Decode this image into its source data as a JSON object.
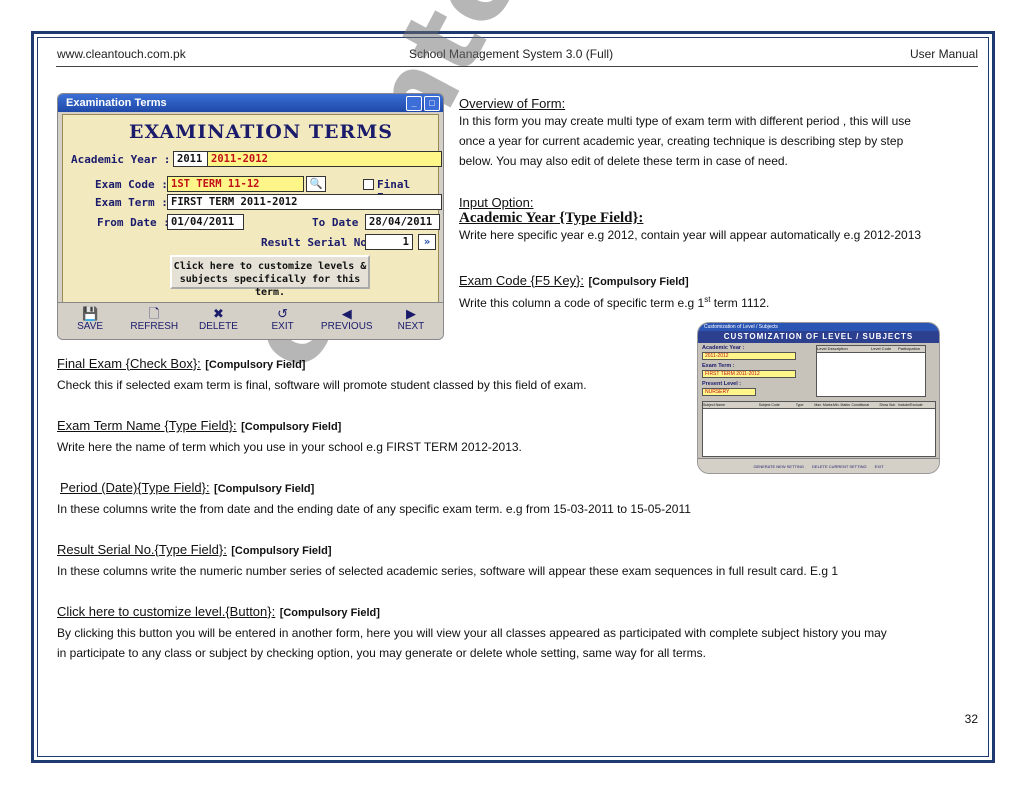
{
  "header": {
    "left": "www.cleantouch.com.pk",
    "center": "School Management System 3.0 (Full)",
    "right": "User Manual"
  },
  "watermark": "cleantouch.com.pk",
  "exam_form": {
    "window_title": "Examination Terms",
    "banner": "EXAMINATION TERMS",
    "academic_year_label": "Academic Year :",
    "academic_year_code": "2011",
    "academic_year_value": "2011-2012",
    "exam_code_label": "Exam Code :",
    "exam_code_value": "1ST TERM 11-12",
    "final_exam_label": "Final Exam",
    "exam_term_label": "Exam Term :",
    "exam_term_value": "FIRST TERM 2011-2012",
    "from_date_label": "From Date :",
    "from_date_value": "01/04/2011",
    "to_date_label": "To Date :",
    "to_date_value": "28/04/2011",
    "result_serial_label": "Result Serial No. :",
    "result_serial_value": "1",
    "customize_button_line1": "Click here to customize levels &",
    "customize_button_line2": "subjects specifically for this term.",
    "toolbar": [
      {
        "label": "SAVE",
        "icon": "save-icon"
      },
      {
        "label": "REFRESH",
        "icon": "refresh-icon"
      },
      {
        "label": "DELETE",
        "icon": "delete-icon"
      },
      {
        "label": "EXIT",
        "icon": "exit-icon"
      },
      {
        "label": "PREVIOUS",
        "icon": "previous-icon"
      },
      {
        "label": "NEXT",
        "icon": "next-icon"
      }
    ]
  },
  "overview": {
    "title": "Overview of Form:",
    "lines": [
      "In this form you may create multi type of exam term with different period , this will use",
      "once a year for current academic year, creating technique is describing step by step",
      "below.  You may also edit of delete these term in case of need."
    ]
  },
  "input_option": {
    "title": "Input Option:",
    "academic_year_title": "Academic Year {Type Field}:",
    "academic_year_text": "Write here specific year e.g 2012, contain year will appear automatically e.g 2012-2013",
    "exam_code_title": "Exam Code {F5 Key}:",
    "exam_code_tag": "[Compulsory Field]",
    "exam_code_text_before": "Write this column a code of specific term e.g 1",
    "exam_code_sup": "st",
    "exam_code_text_after": " term 1112."
  },
  "customization_form": {
    "window_title": "Customization of Level / Subjects",
    "title": "CUSTOMIZATION OF LEVEL / SUBJECTS",
    "academic_year_label": "Academic Year :",
    "academic_year_value": "2011-2012",
    "exam_term_label": "Exam Term :",
    "exam_term_value": "FIRST TERM 2011-2012",
    "present_level_label": "Present Level :",
    "present_level_value": "NURSERY",
    "level_columns": [
      "Level Description",
      "Level Code",
      "Participation"
    ],
    "grid_columns": [
      "Subject Name",
      "Subject Code",
      "Type",
      "Max. Marks",
      "Min. Marks",
      "Conditional",
      "Show Sub",
      "Include/Exclude"
    ],
    "footer_buttons": [
      "GENERATE NEW SETTING",
      "DELETE CURRENT SETTING",
      "EXIT"
    ]
  },
  "sections": [
    {
      "title": "Final Exam {Check Box}:",
      "tag": "[Compulsory Field]",
      "lines": [
        "Check this if selected exam term is final, software will promote student classed by this field of exam."
      ]
    },
    {
      "title": "Exam Term Name {Type Field}:",
      "tag": "[Compulsory Field]",
      "lines": [
        "Write here the name of term which you use in your school e.g FIRST TERM 2012-2013."
      ]
    },
    {
      "title": "Period (Date){Type Field}:",
      "tag": "[Compulsory Field]",
      "lines": [
        "In these columns write the from date and the ending date of any specific exam term. e.g from 15-03-2011 to 15-05-2011"
      ]
    },
    {
      "title": "Result Serial No.{Type Field}:",
      "tag": "[Compulsory Field]",
      "lines": [
        "In these columns write the numeric number series of selected academic series, software will appear these exam sequences in full result card.  E.g 1"
      ]
    },
    {
      "title": "Click here to customize level.{Button}:",
      "tag": "[Compulsory Field]",
      "lines": [
        "By clicking this button you will be entered in another form, here you will view your all classes appeared as participated with complete subject history you may",
        "in participate to any class or subject by checking option, you may generate or delete whole setting, same way for all terms."
      ]
    }
  ],
  "page_number": "32"
}
